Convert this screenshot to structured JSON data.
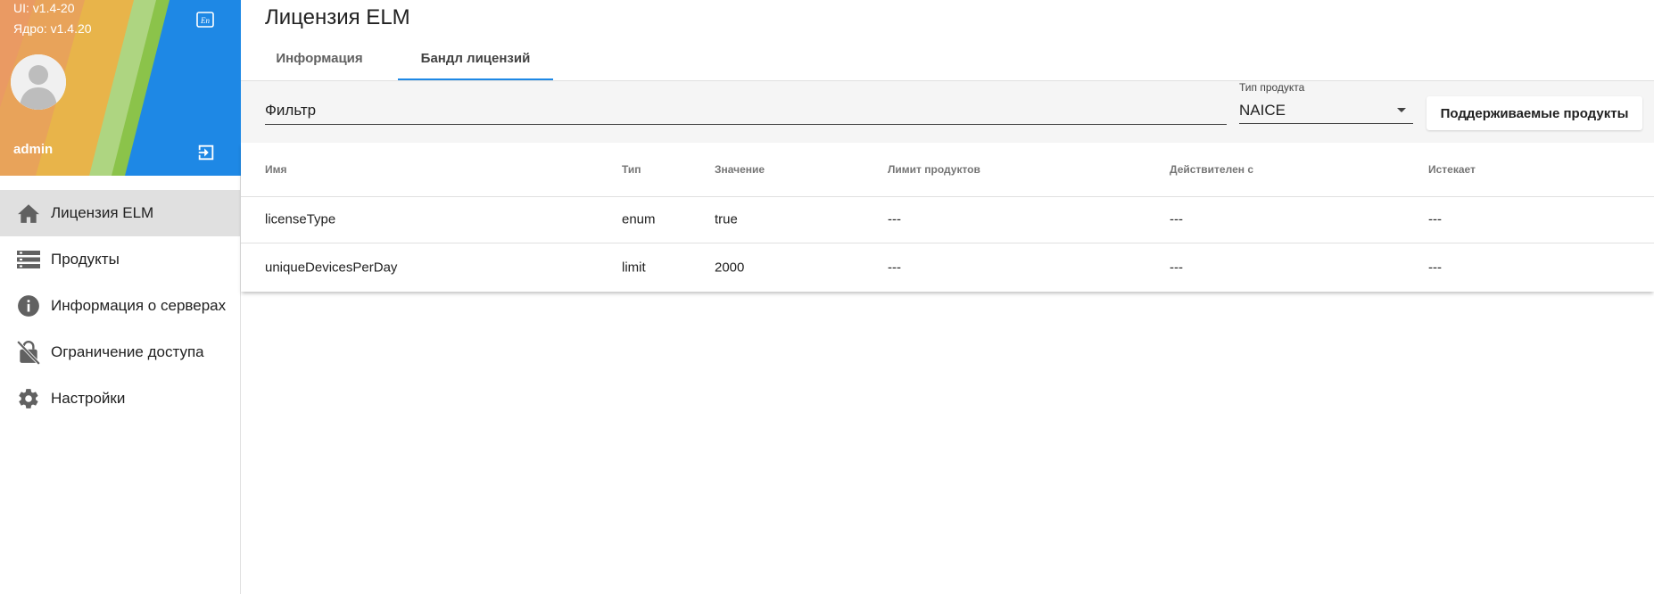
{
  "sidebar": {
    "version_ui": "UI: v1.4-20",
    "version_core": "Ядро: v1.4.20",
    "lang_icon_text": "En",
    "username": "admin",
    "items": [
      {
        "label": "Лицензия ELM",
        "icon": "home-icon",
        "active": true
      },
      {
        "label": "Продукты",
        "icon": "list-icon",
        "active": false
      },
      {
        "label": "Информация о серверах",
        "icon": "info-icon",
        "active": false
      },
      {
        "label": "Ограничение доступа",
        "icon": "lock-off-icon",
        "active": false
      },
      {
        "label": "Настройки",
        "icon": "gear-icon",
        "active": false
      }
    ]
  },
  "main": {
    "title": "Лицензия ELM",
    "tabs": [
      {
        "label": "Информация",
        "active": false
      },
      {
        "label": "Бандл лицензий",
        "active": true
      }
    ],
    "filter": {
      "placeholder": "Фильтр",
      "product_type_label": "Тип продукта",
      "product_type_value": "NAICE",
      "supported_button": "Поддерживаемые продукты"
    },
    "table": {
      "columns": [
        "Имя",
        "Тип",
        "Значение",
        "Лимит продуктов",
        "Действителен с",
        "Истекает"
      ],
      "rows": [
        [
          "licenseType",
          "enum",
          "true",
          "---",
          "---",
          "---"
        ],
        [
          "uniqueDevicesPerDay",
          "limit",
          "2000",
          "---",
          "---",
          "---"
        ]
      ]
    }
  },
  "colors": {
    "accent": "#1e88e5",
    "sidebar_active": "#e0e0e0",
    "filter_bg": "#f5f5f5"
  }
}
